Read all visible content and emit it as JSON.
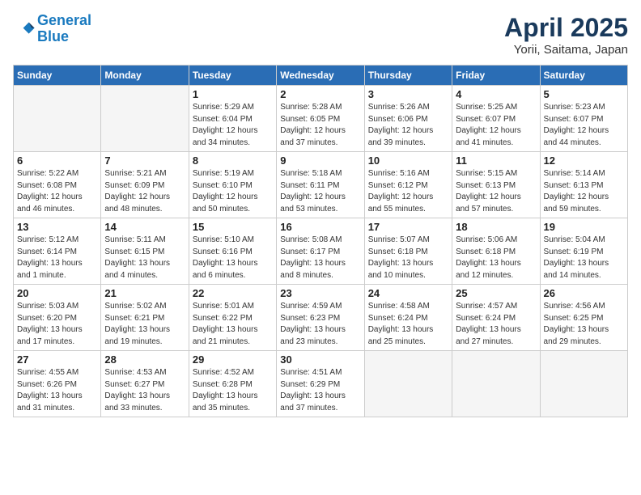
{
  "header": {
    "logo_line1": "General",
    "logo_line2": "Blue",
    "title": "April 2025",
    "subtitle": "Yorii, Saitama, Japan"
  },
  "weekdays": [
    "Sunday",
    "Monday",
    "Tuesday",
    "Wednesday",
    "Thursday",
    "Friday",
    "Saturday"
  ],
  "weeks": [
    [
      {
        "day": "",
        "info": ""
      },
      {
        "day": "",
        "info": ""
      },
      {
        "day": "1",
        "info": "Sunrise: 5:29 AM\nSunset: 6:04 PM\nDaylight: 12 hours\nand 34 minutes."
      },
      {
        "day": "2",
        "info": "Sunrise: 5:28 AM\nSunset: 6:05 PM\nDaylight: 12 hours\nand 37 minutes."
      },
      {
        "day": "3",
        "info": "Sunrise: 5:26 AM\nSunset: 6:06 PM\nDaylight: 12 hours\nand 39 minutes."
      },
      {
        "day": "4",
        "info": "Sunrise: 5:25 AM\nSunset: 6:07 PM\nDaylight: 12 hours\nand 41 minutes."
      },
      {
        "day": "5",
        "info": "Sunrise: 5:23 AM\nSunset: 6:07 PM\nDaylight: 12 hours\nand 44 minutes."
      }
    ],
    [
      {
        "day": "6",
        "info": "Sunrise: 5:22 AM\nSunset: 6:08 PM\nDaylight: 12 hours\nand 46 minutes."
      },
      {
        "day": "7",
        "info": "Sunrise: 5:21 AM\nSunset: 6:09 PM\nDaylight: 12 hours\nand 48 minutes."
      },
      {
        "day": "8",
        "info": "Sunrise: 5:19 AM\nSunset: 6:10 PM\nDaylight: 12 hours\nand 50 minutes."
      },
      {
        "day": "9",
        "info": "Sunrise: 5:18 AM\nSunset: 6:11 PM\nDaylight: 12 hours\nand 53 minutes."
      },
      {
        "day": "10",
        "info": "Sunrise: 5:16 AM\nSunset: 6:12 PM\nDaylight: 12 hours\nand 55 minutes."
      },
      {
        "day": "11",
        "info": "Sunrise: 5:15 AM\nSunset: 6:13 PM\nDaylight: 12 hours\nand 57 minutes."
      },
      {
        "day": "12",
        "info": "Sunrise: 5:14 AM\nSunset: 6:13 PM\nDaylight: 12 hours\nand 59 minutes."
      }
    ],
    [
      {
        "day": "13",
        "info": "Sunrise: 5:12 AM\nSunset: 6:14 PM\nDaylight: 13 hours\nand 1 minute."
      },
      {
        "day": "14",
        "info": "Sunrise: 5:11 AM\nSunset: 6:15 PM\nDaylight: 13 hours\nand 4 minutes."
      },
      {
        "day": "15",
        "info": "Sunrise: 5:10 AM\nSunset: 6:16 PM\nDaylight: 13 hours\nand 6 minutes."
      },
      {
        "day": "16",
        "info": "Sunrise: 5:08 AM\nSunset: 6:17 PM\nDaylight: 13 hours\nand 8 minutes."
      },
      {
        "day": "17",
        "info": "Sunrise: 5:07 AM\nSunset: 6:18 PM\nDaylight: 13 hours\nand 10 minutes."
      },
      {
        "day": "18",
        "info": "Sunrise: 5:06 AM\nSunset: 6:18 PM\nDaylight: 13 hours\nand 12 minutes."
      },
      {
        "day": "19",
        "info": "Sunrise: 5:04 AM\nSunset: 6:19 PM\nDaylight: 13 hours\nand 14 minutes."
      }
    ],
    [
      {
        "day": "20",
        "info": "Sunrise: 5:03 AM\nSunset: 6:20 PM\nDaylight: 13 hours\nand 17 minutes."
      },
      {
        "day": "21",
        "info": "Sunrise: 5:02 AM\nSunset: 6:21 PM\nDaylight: 13 hours\nand 19 minutes."
      },
      {
        "day": "22",
        "info": "Sunrise: 5:01 AM\nSunset: 6:22 PM\nDaylight: 13 hours\nand 21 minutes."
      },
      {
        "day": "23",
        "info": "Sunrise: 4:59 AM\nSunset: 6:23 PM\nDaylight: 13 hours\nand 23 minutes."
      },
      {
        "day": "24",
        "info": "Sunrise: 4:58 AM\nSunset: 6:24 PM\nDaylight: 13 hours\nand 25 minutes."
      },
      {
        "day": "25",
        "info": "Sunrise: 4:57 AM\nSunset: 6:24 PM\nDaylight: 13 hours\nand 27 minutes."
      },
      {
        "day": "26",
        "info": "Sunrise: 4:56 AM\nSunset: 6:25 PM\nDaylight: 13 hours\nand 29 minutes."
      }
    ],
    [
      {
        "day": "27",
        "info": "Sunrise: 4:55 AM\nSunset: 6:26 PM\nDaylight: 13 hours\nand 31 minutes."
      },
      {
        "day": "28",
        "info": "Sunrise: 4:53 AM\nSunset: 6:27 PM\nDaylight: 13 hours\nand 33 minutes."
      },
      {
        "day": "29",
        "info": "Sunrise: 4:52 AM\nSunset: 6:28 PM\nDaylight: 13 hours\nand 35 minutes."
      },
      {
        "day": "30",
        "info": "Sunrise: 4:51 AM\nSunset: 6:29 PM\nDaylight: 13 hours\nand 37 minutes."
      },
      {
        "day": "",
        "info": ""
      },
      {
        "day": "",
        "info": ""
      },
      {
        "day": "",
        "info": ""
      }
    ]
  ]
}
